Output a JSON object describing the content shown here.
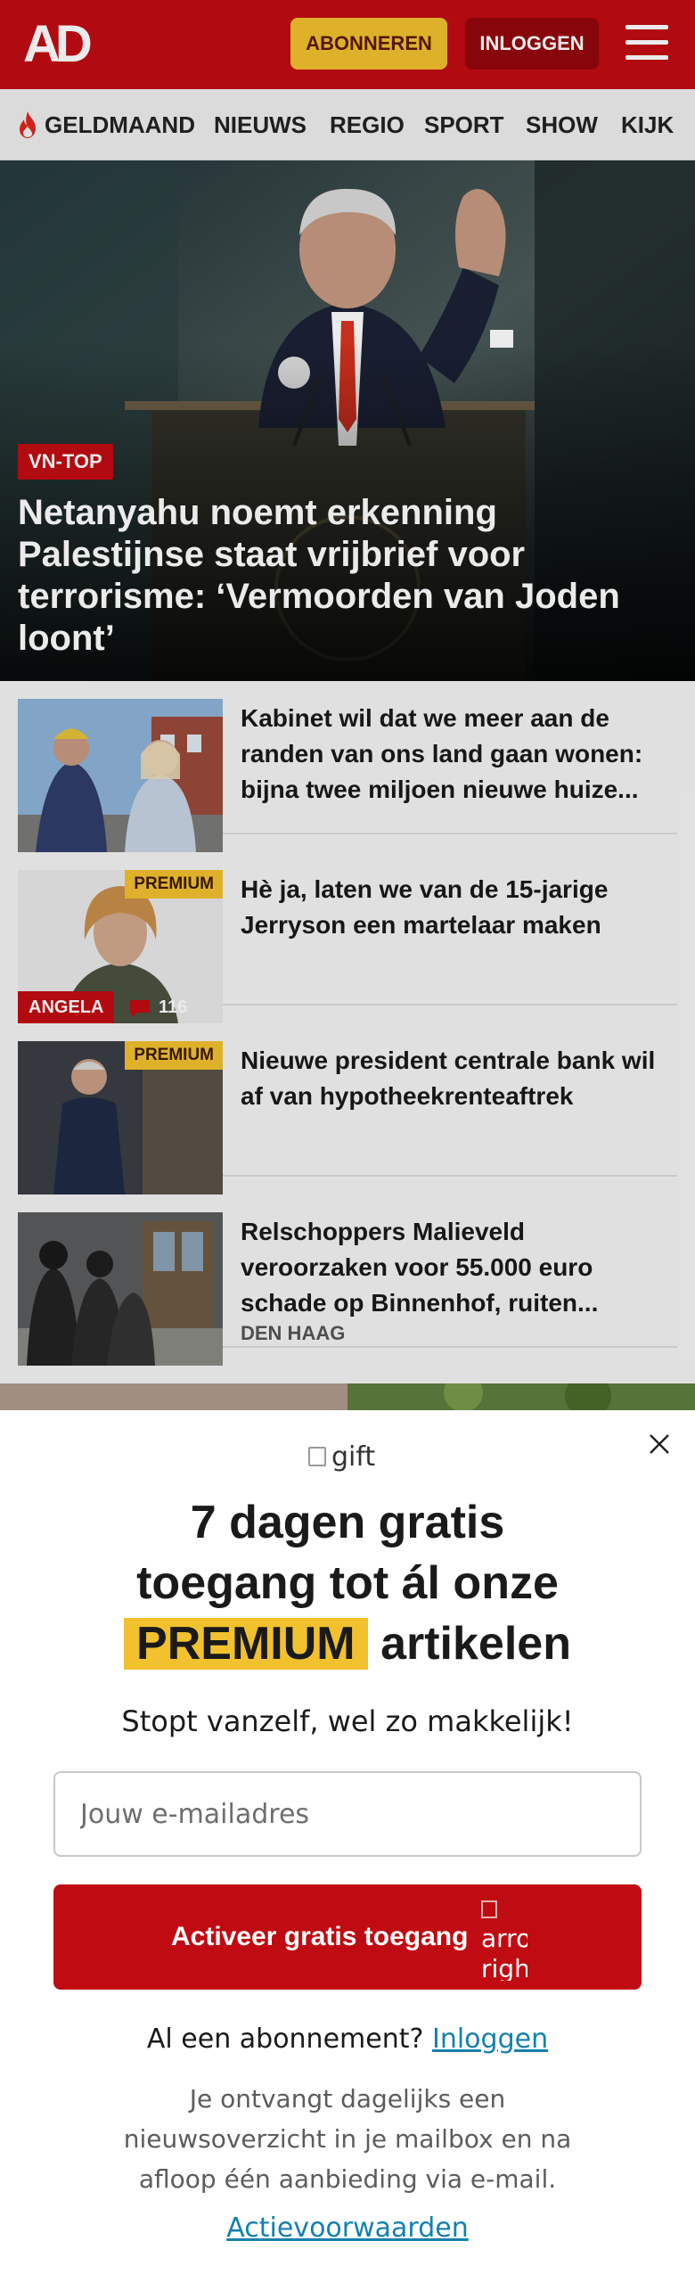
{
  "header": {
    "logo": "AD",
    "subscribe_label": "ABONNEREN",
    "login_label": "INLOGGEN",
    "brand_color": "#c00b12",
    "accent_color": "#f2c12e"
  },
  "nav": {
    "items": [
      {
        "label": "GELDMAAND",
        "icon": "flame-icon"
      },
      {
        "label": "NIEUWS"
      },
      {
        "label": "REGIO"
      },
      {
        "label": "SPORT"
      },
      {
        "label": "SHOW"
      },
      {
        "label": "KIJK"
      }
    ]
  },
  "hero": {
    "tag": "VN-TOP",
    "title": "Netanyahu noemt erkenning Palestijnse staat vrijbrief voor terrorisme: ‘Vermoorden van Joden loont’"
  },
  "articles": [
    {
      "title": "Kabinet wil dat we meer aan de randen van ons land gaan wonen: bijna twee miljoen nieuwe huize..."
    },
    {
      "title": "Hè ja, laten we van de 15-jarige Jerryson een martelaar maken",
      "badge": "PREMIUM",
      "author": "ANGELA",
      "comments": "116"
    },
    {
      "title": "Nieuwe president centrale bank wil af van hypotheekrenteaftrek",
      "badge": "PREMIUM"
    },
    {
      "title": "Relschoppers Malieveld veroorzaken voor 55.000 euro schade op Binnenhof, ruiten...",
      "place": "DEN HAAG"
    }
  ],
  "modal": {
    "gift_alt": "gift",
    "headline_line1": "7 dagen gratis",
    "headline_line2": "toegang tot ál onze",
    "headline_highlight": "PREMIUM",
    "headline_line3_rest": "artikelen",
    "subtitle": "Stopt vanzelf, wel zo makkelijk!",
    "email_placeholder": "Jouw e-mailadres",
    "cta_label": "Activeer gratis toegang",
    "cta_icon_alt": "arrow right",
    "already_text": "Al een abonnement?",
    "already_link": "Inloggen",
    "info_text": "Je ontvangt dagelijks een nieuwsoverzicht in je mailbox en na afloop één aanbieding via e-mail.",
    "terms_link": "Actievoorwaarden"
  }
}
